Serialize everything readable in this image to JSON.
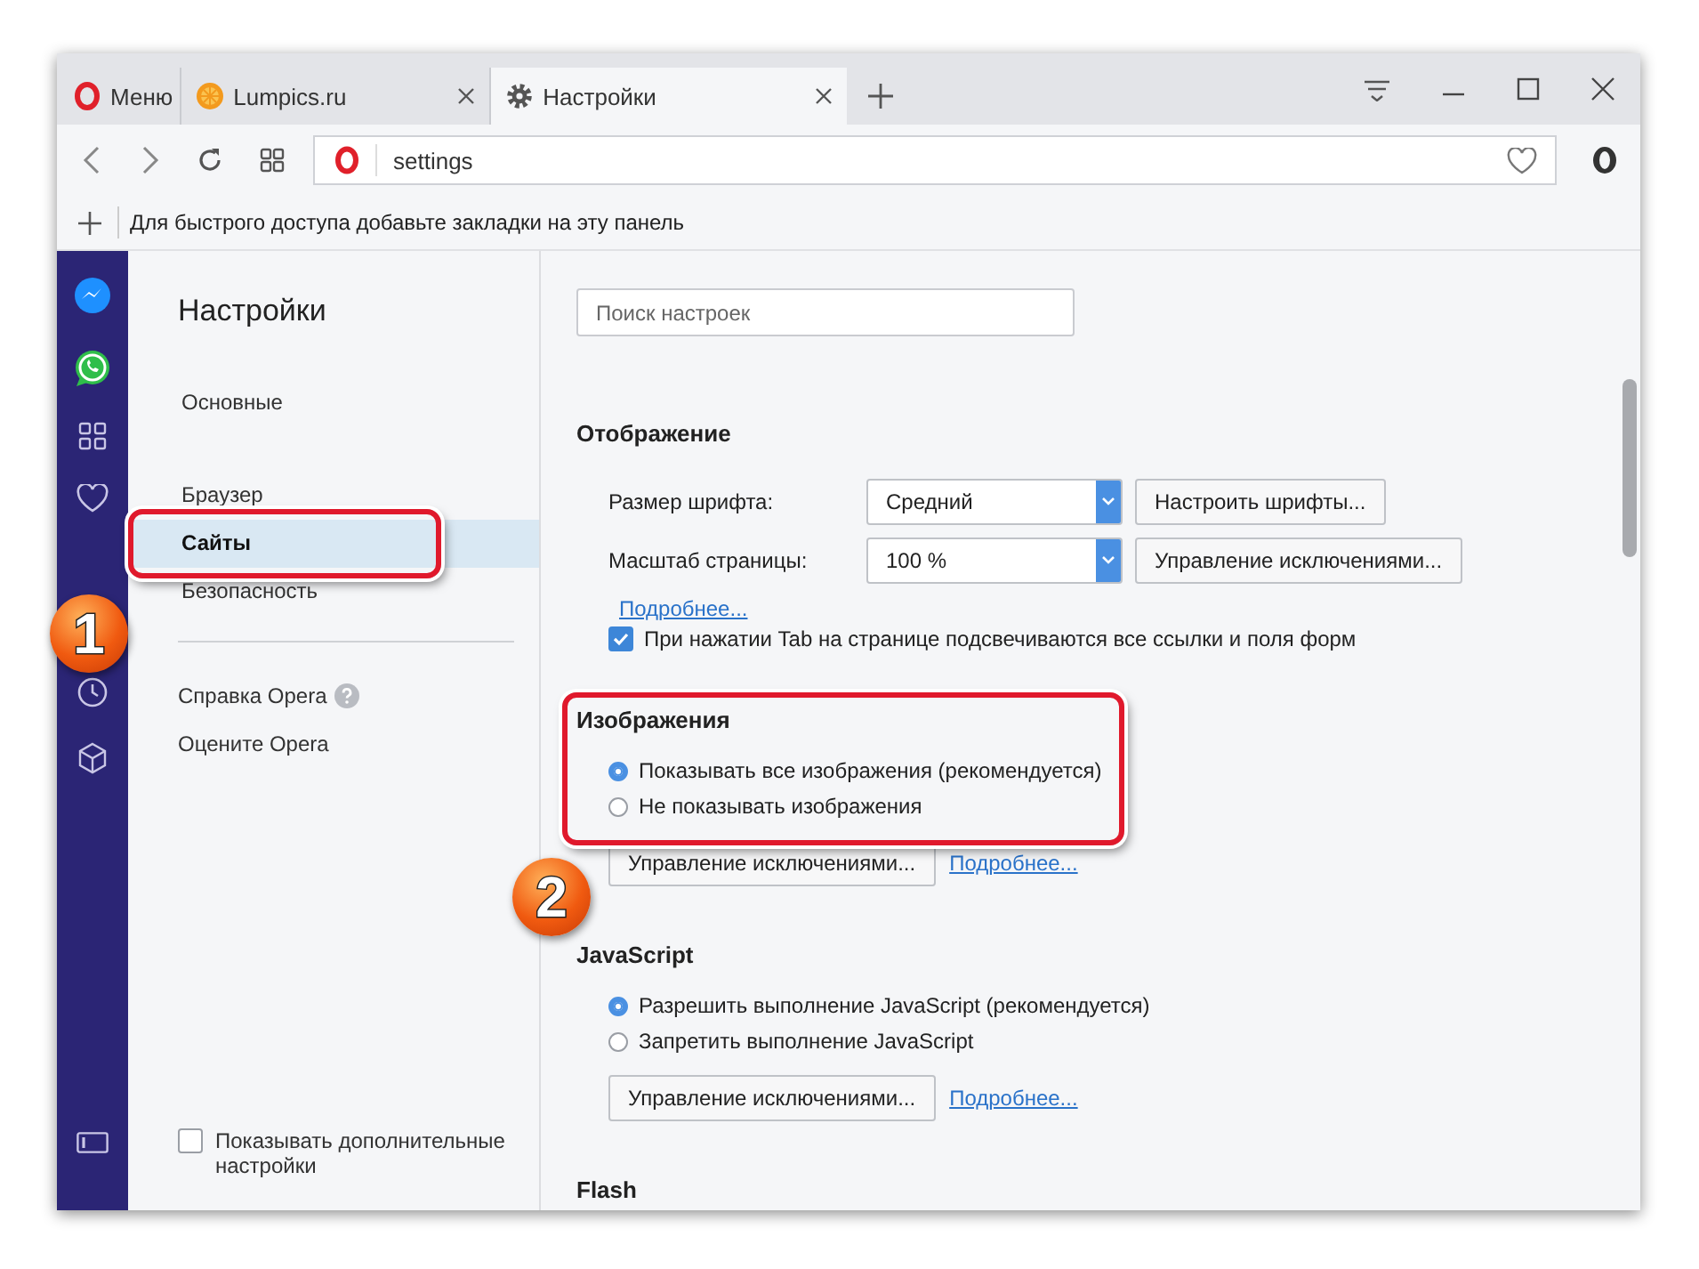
{
  "tabs": [
    {
      "label": "Меню",
      "kind": "menu",
      "selected": false
    },
    {
      "label": "Lumpics.ru",
      "kind": "site",
      "selected": false
    },
    {
      "label": "Настройки",
      "kind": "settings",
      "selected": true
    }
  ],
  "address": {
    "value": "settings"
  },
  "bookmarks_bar": {
    "hint": "Для быстрого доступа добавьте закладки на эту панель"
  },
  "settings_nav": {
    "title": "Настройки",
    "groups": [
      [
        {
          "label": "Основные",
          "selected": false
        }
      ],
      [
        {
          "label": "Браузер",
          "selected": false
        },
        {
          "label": "Сайты",
          "selected": true
        },
        {
          "label": "Безопасность",
          "selected": false
        }
      ]
    ],
    "links": [
      {
        "label": "Справка Opera",
        "help": true
      },
      {
        "label": "Оцените Opera",
        "help": false
      }
    ],
    "advanced": {
      "label": "Показывать дополнительные настройки",
      "checked": false
    }
  },
  "search": {
    "placeholder": "Поиск настроек"
  },
  "sections": [
    {
      "title": "Отображение",
      "rows": [
        {
          "label": "Размер шрифта:",
          "value": "Средний",
          "button": "Настроить шрифты..."
        },
        {
          "label": "Масштаб страницы:",
          "value": "100 %",
          "button": "Управление исключениями..."
        }
      ],
      "link": "Подробнее...",
      "checkboxes": [
        {
          "label": "При нажатии Tab на странице подсвечиваются все ссылки и поля форм",
          "checked": true
        }
      ]
    },
    {
      "title": "Изображения",
      "options": [
        {
          "label": "Показывать все изображения (рекомендуется)",
          "selected": true
        },
        {
          "label": "Не показывать изображения",
          "selected": false
        }
      ],
      "actions": {
        "button": "Управление исключениями...",
        "link": "Подробнее..."
      }
    },
    {
      "title": "JavaScript",
      "options": [
        {
          "label": "Разрешить выполнение JavaScript (рекомендуется)",
          "selected": true
        },
        {
          "label": "Запретить выполнение JavaScript",
          "selected": false
        }
      ],
      "actions": {
        "button": "Управление исключениями...",
        "link": "Подробнее..."
      }
    },
    {
      "title": "Flash"
    }
  ],
  "callouts": [
    {
      "number": "1"
    },
    {
      "number": "2"
    }
  ]
}
